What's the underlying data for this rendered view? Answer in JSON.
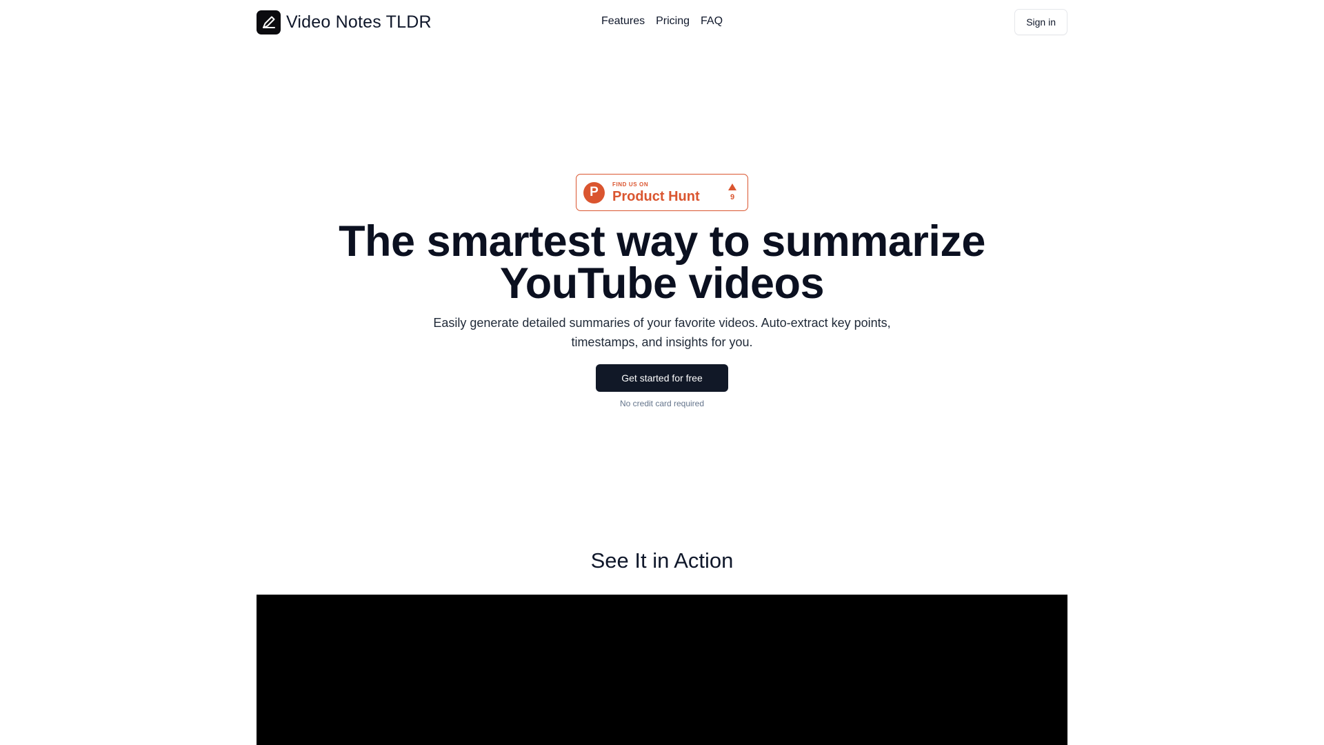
{
  "header": {
    "brand_name": "Video Notes TLDR",
    "nav": [
      {
        "label": "Features"
      },
      {
        "label": "Pricing"
      },
      {
        "label": "FAQ"
      }
    ],
    "signin_label": "Sign in"
  },
  "hero": {
    "badge": {
      "small": "FIND US ON",
      "big": "Product Hunt",
      "count": "9",
      "logo_letter": "P",
      "color": "#da552f"
    },
    "headline_line1": "The smartest way to summarize",
    "headline_line2": "YouTube videos",
    "subtext_line1": "Easily generate detailed summaries of your favorite videos. Auto-extract key points,",
    "subtext_line2": "timestamps, and insights for you.",
    "cta_label": "Get started for free",
    "note": "No credit card required"
  },
  "demo": {
    "title": "See It in Action"
  },
  "colors": {
    "primary_dark": "#111827",
    "accent": "#da552f"
  },
  "icons": {
    "brand": "pencil-icon",
    "badge_arrow": "upvote-arrow-icon"
  }
}
